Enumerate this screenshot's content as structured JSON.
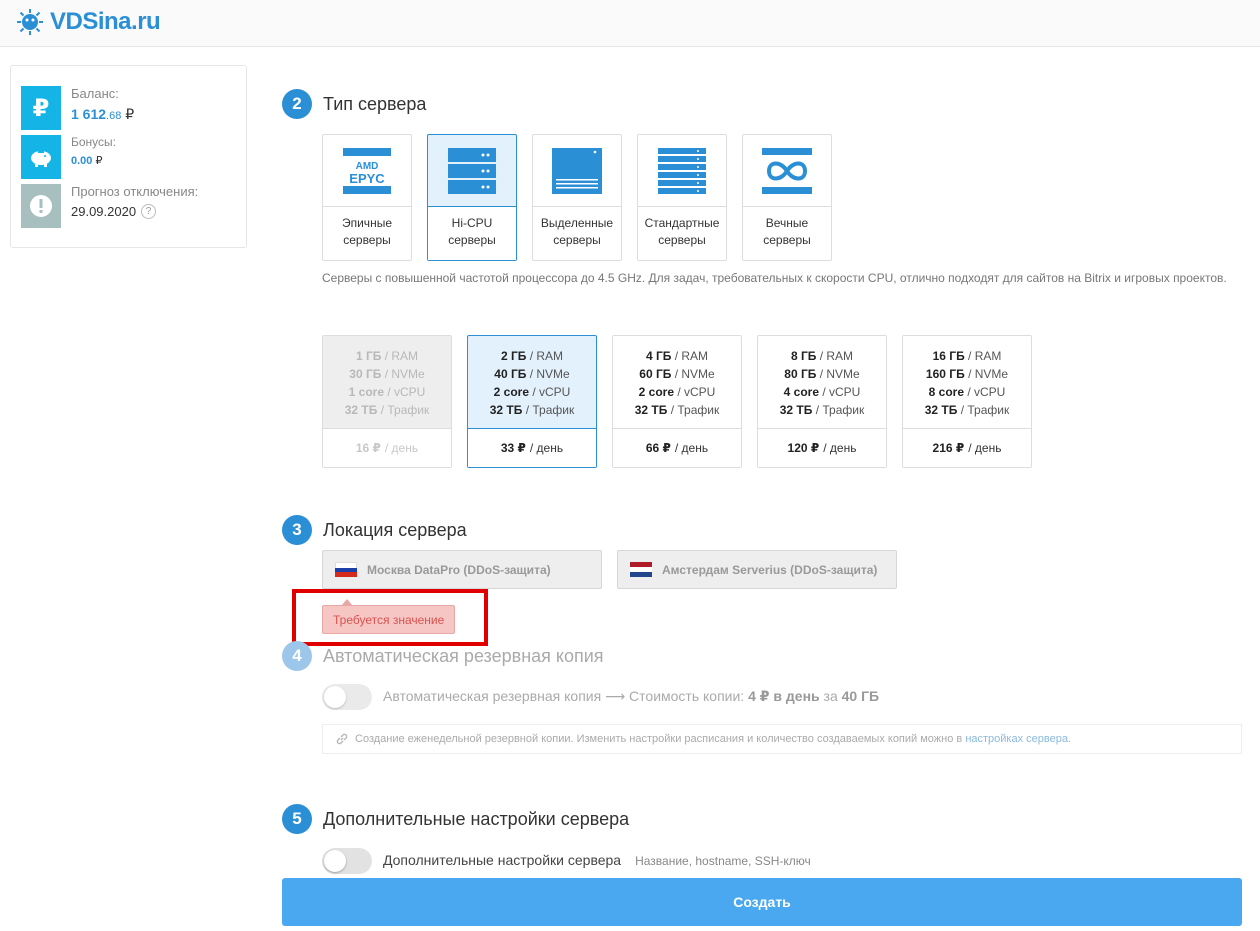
{
  "header": {
    "logo_text": "VDSina.ru"
  },
  "balance": {
    "balance_label": "Баланс:",
    "balance_int": "1 612",
    "balance_dec": ".68",
    "currency": "₽",
    "bonus_label": "Бонусы:",
    "bonus_value": "0.00",
    "forecast_label": "Прогноз отключения:",
    "forecast_date": "29.09.2020",
    "help_glyph": "?"
  },
  "section_type": {
    "number": "2",
    "title": "Тип сервера",
    "cards": [
      {
        "label": "Эпичные\nсерверы",
        "icon": "amd-epyc-icon"
      },
      {
        "label": "Hi-CPU\nсерверы",
        "icon": "server-rack-icon"
      },
      {
        "label": "Выделенные\nсерверы",
        "icon": "dedicated-server-icon"
      },
      {
        "label": "Стандартные\nсерверы",
        "icon": "server-stack-icon"
      },
      {
        "label": "Вечные\nсерверы",
        "icon": "infinity-icon"
      }
    ],
    "amd_text": "AMD",
    "epyc_text": "EPYC",
    "description": "Серверы с повышенной частотой процессора до 4.5 GHz. Для задач, требовательных к скорости CPU, отлично подходят для сайтов на Bitrix и игровых проектов."
  },
  "plans": [
    {
      "ram": "1 ГБ",
      "disk": "30 ГБ",
      "cpu": "1 core",
      "traffic": "32 ТБ",
      "price": "16 ₽",
      "state": "disabled"
    },
    {
      "ram": "2 ГБ",
      "disk": "40 ГБ",
      "cpu": "2 core",
      "traffic": "32 ТБ",
      "price": "33 ₽",
      "state": "selected"
    },
    {
      "ram": "4 ГБ",
      "disk": "60 ГБ",
      "cpu": "2 core",
      "traffic": "32 ТБ",
      "price": "66 ₽",
      "state": "normal"
    },
    {
      "ram": "8 ГБ",
      "disk": "80 ГБ",
      "cpu": "4 core",
      "traffic": "32 ТБ",
      "price": "120 ₽",
      "state": "normal"
    },
    {
      "ram": "16 ГБ",
      "disk": "160 ГБ",
      "cpu": "8 core",
      "traffic": "32 ТБ",
      "price": "216 ₽",
      "state": "normal"
    }
  ],
  "plan_units": {
    "ram": "/ RAM",
    "disk": "/ NVMe",
    "cpu": "/ vCPU",
    "traffic": "/ Трафик",
    "per_day": "/ день"
  },
  "section_location": {
    "number": "3",
    "title": "Локация сервера",
    "moscow": "Москва DataPro (DDoS-защита)",
    "amsterdam": "Амстердам Serverius (DDoS-защита)",
    "error": "Требуется значение"
  },
  "section_backup": {
    "number": "4",
    "title": "Автоматическая резервная копия",
    "line_prefix": "Автоматическая резервная копия ⟶ Стоимость копии:",
    "cost": "4 ₽ в день",
    "for": "за",
    "size": "40 ГБ",
    "note": "Создание еженедельной резервной копии. Изменить настройки расписания и количество создаваемых копий можно в",
    "note_link": "настройках сервера",
    "note_end": "."
  },
  "section_extra": {
    "number": "5",
    "title": "Дополнительные настройки сервера",
    "toggle_label": "Дополнительные настройки сервера",
    "hint": "Название, hostname, SSH-ключ"
  },
  "create_button": "Создать",
  "colors": {
    "accent": "#2b8fd6",
    "button": "#4aa8f0",
    "error": "#e00000"
  }
}
